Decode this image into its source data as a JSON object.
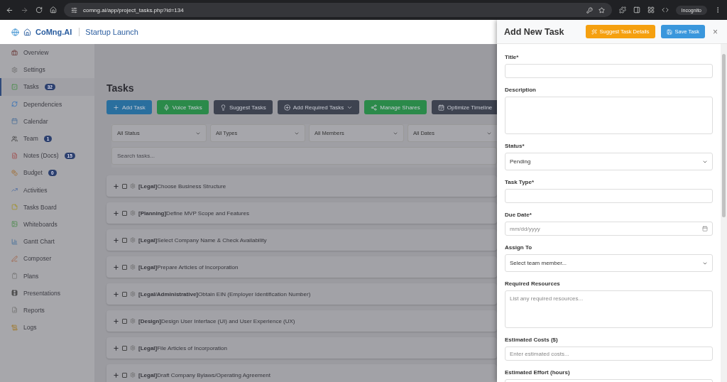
{
  "browser": {
    "url": "comng.ai/app/project_tasks.php?id=134",
    "profile": "Incognito"
  },
  "header": {
    "brand": "CoMng.AI",
    "project": "Startup Launch"
  },
  "sidebar": {
    "items": [
      {
        "label": "Overview",
        "selected": false
      },
      {
        "label": "Settings",
        "selected": false
      },
      {
        "label": "Tasks",
        "badge": "32",
        "selected": true
      },
      {
        "label": "Dependencies",
        "selected": false
      },
      {
        "label": "Calendar",
        "selected": false
      },
      {
        "label": "Team",
        "badge": "1",
        "selected": false
      },
      {
        "label": "Notes (Docs)",
        "badge": "15",
        "selected": false
      },
      {
        "label": "Budget",
        "badge": "0",
        "selected": false
      },
      {
        "label": "Activities",
        "selected": false
      },
      {
        "label": "Tasks Board",
        "selected": false
      },
      {
        "label": "Whiteboards",
        "selected": false
      },
      {
        "label": "Gantt Chart",
        "selected": false
      },
      {
        "label": "Composer",
        "selected": false
      },
      {
        "label": "Plans",
        "selected": false
      },
      {
        "label": "Presentations",
        "selected": false
      },
      {
        "label": "Reports",
        "selected": false
      },
      {
        "label": "Logs",
        "selected": false
      }
    ]
  },
  "main": {
    "title": "Tasks",
    "actions": [
      {
        "label": "Add Task",
        "color": "#2a6f9e"
      },
      {
        "label": "Voice Tasks",
        "color": "#2b8a4a"
      },
      {
        "label": "Suggest Tasks",
        "color": "#3e4350"
      },
      {
        "label": "Add Required Tasks",
        "color": "#3e4350",
        "dropdown": true
      },
      {
        "label": "Manage Shares",
        "color": "#2b8a4a"
      },
      {
        "label": "Optimize Timeline",
        "color": "#3e4350"
      }
    ],
    "filters": [
      "All Status",
      "All Types",
      "All Members",
      "All Dates"
    ],
    "search": {
      "placeholder": "Search tasks..."
    },
    "tasks": [
      {
        "text": "**[Legal]**Choose Business Structure",
        "checked": false
      },
      {
        "text": "**[Planning]**Define MVP Scope and Features",
        "checked": false
      },
      {
        "text": "**[Legal]**Select Company Name & Check Availability",
        "checked": false
      },
      {
        "text": "**[Legal]**Prepare Articles of Incorporation",
        "checked": false
      },
      {
        "text": "**[Legal/Administrative]**Obtain EIN (Employer Identification Number)",
        "checked": false
      },
      {
        "text": "**[Design]**Design User Interface (UI) and User Experience (UX)",
        "checked": false
      },
      {
        "text": "**[Legal]**File Articles of Incorporation",
        "checked": false
      },
      {
        "text": "**[Legal]**Draft Company Bylaws/Operating Agreement",
        "checked": false
      }
    ]
  },
  "panel": {
    "title": "Add New Task",
    "suggest_button": "Suggest Task Details",
    "save_button": "Save Task",
    "close": "×",
    "fields": [
      {
        "kind": "input",
        "label": "Title*"
      },
      {
        "kind": "textarea",
        "label": "Description"
      },
      {
        "kind": "select",
        "label": "Status*",
        "value": "Pending"
      },
      {
        "kind": "input",
        "label": "Task Type*"
      },
      {
        "kind": "date",
        "label": "Due Date*",
        "placeholder": "mm/dd/yyyy"
      },
      {
        "kind": "select",
        "label": "Assign To",
        "value": "Select team member..."
      },
      {
        "kind": "textarea",
        "label": "Required Resources",
        "placeholder": "List any required resources..."
      },
      {
        "kind": "input",
        "label": "Estimated Costs ($)",
        "placeholder": "Enter estimated costs..."
      },
      {
        "kind": "input",
        "label": "Estimated Effort (hours)"
      }
    ]
  }
}
